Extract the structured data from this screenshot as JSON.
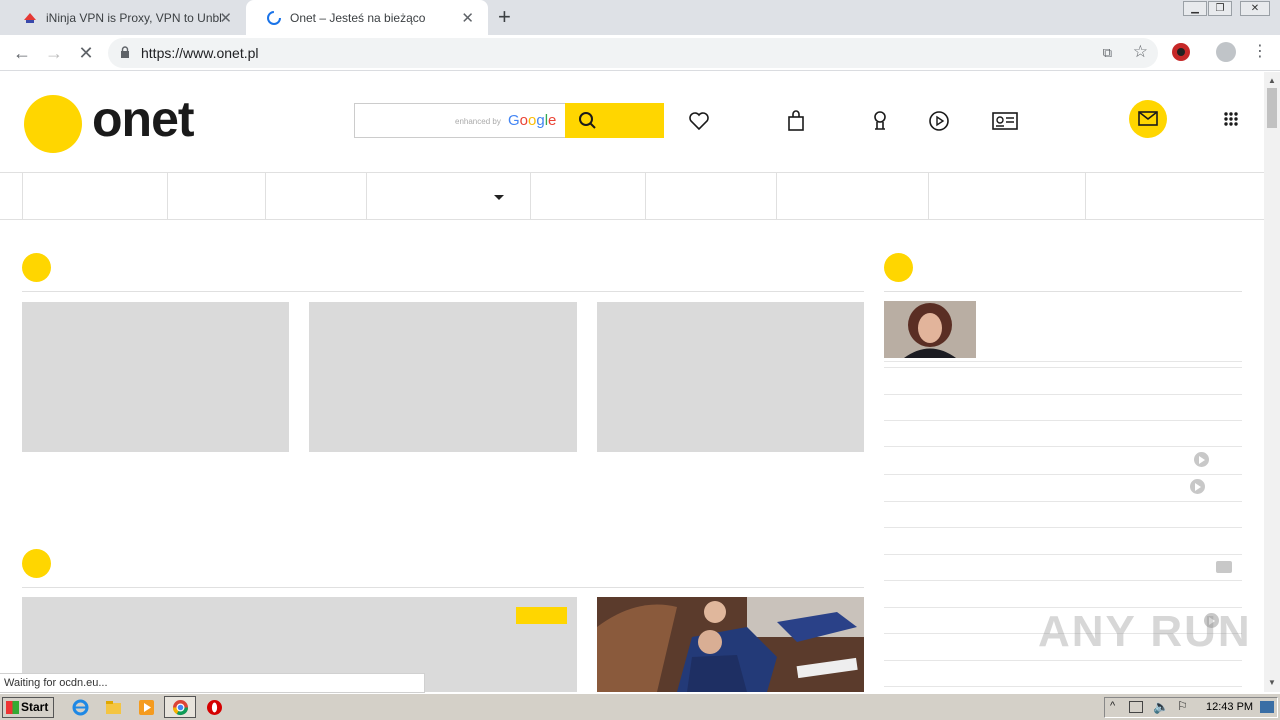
{
  "browser": {
    "tabs": [
      {
        "title": "iNinja VPN is Proxy, VPN to Unblock a",
        "active": false
      },
      {
        "title": "Onet – Jesteś na bieżąco",
        "active": true
      }
    ],
    "url": "https://www.onet.pl",
    "translate_glyph": "⧉",
    "status_text": "Waiting for ocdn.eu..."
  },
  "site": {
    "logo": "onet",
    "brand_color": "#ffd600",
    "search": {
      "enhanced_label": "enhanced by",
      "google_label": "Google"
    }
  },
  "watermark": "ANY RUN",
  "taskbar": {
    "start_label": "Start",
    "clock": "12:43 PM"
  }
}
